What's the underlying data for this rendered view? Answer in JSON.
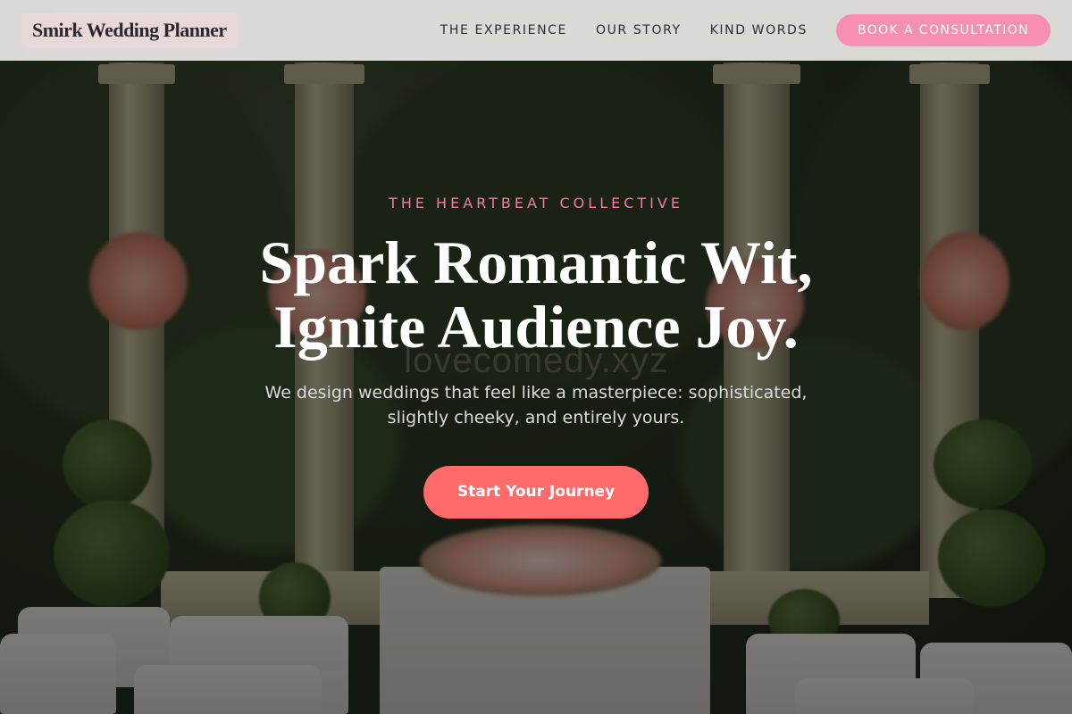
{
  "header": {
    "logo": "Smirk Wedding Planner",
    "nav": [
      {
        "label": "THE EXPERIENCE"
      },
      {
        "label": "OUR STORY"
      },
      {
        "label": "KIND WORDS"
      }
    ],
    "cta_label": "BOOK A CONSULTATION"
  },
  "hero": {
    "eyebrow": "THE HEARTBEAT COLLECTIVE",
    "headline_line1": "Spark Romantic Wit,",
    "headline_line2": "Ignite Audience Joy.",
    "subtext_line1": "We design weddings that feel like a masterpiece: sophisticated,",
    "subtext_line2": "slightly cheeky, and entirely yours.",
    "button_label": "Start Your Journey",
    "watermark": "lovecomedy.xyz"
  },
  "colors": {
    "accent_pink": "#f78fb3",
    "eyebrow_pink": "#f07ba3",
    "button_coral": "#ff6b6b",
    "header_bg": "#e8e6e2"
  }
}
